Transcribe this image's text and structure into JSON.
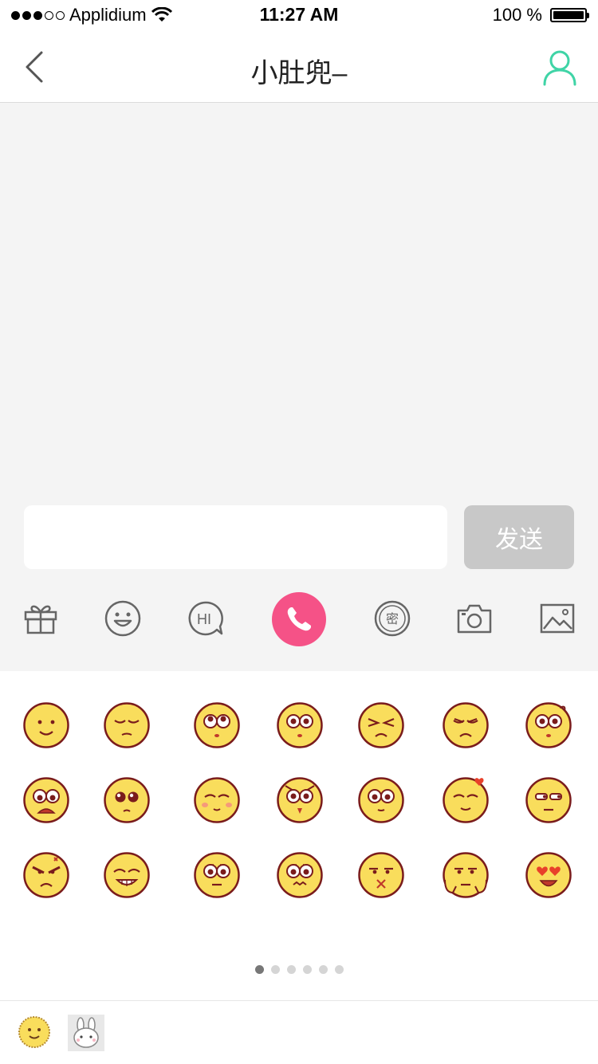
{
  "status_bar": {
    "carrier": "Applidium",
    "time": "11:27 AM",
    "battery": "100 %"
  },
  "nav": {
    "title": "小肚兜–"
  },
  "composer": {
    "input_value": "",
    "send_label": "发送"
  },
  "toolbar": {
    "items": [
      "gift-icon",
      "smiley-icon",
      "hi-bubble-icon",
      "phone-call-icon",
      "secret-stamp-icon",
      "camera-icon",
      "image-icon"
    ],
    "secret_glyph": "密",
    "hi_text": "HI",
    "call_color": "#f55287"
  },
  "emoji_panel": {
    "rows": [
      [
        "smile",
        "sleepy",
        "eyes-up",
        "stare",
        "squint",
        "sad",
        "confused"
      ],
      [
        "shocked",
        "sparkle-eyes",
        "blush",
        "owl",
        "dizzy",
        "love",
        "smirk"
      ],
      [
        "angry",
        "grin",
        "worried",
        "nervous",
        "x-mouth",
        "hug",
        "heart-eyes"
      ]
    ],
    "page_count": 6,
    "active_page": 1,
    "face_color": "#f9dd5c",
    "outline_color": "#7a1c1c"
  },
  "bottom_tabs": [
    {
      "name": "emoji-tab",
      "active": true
    },
    {
      "name": "bunny-sticker-tab",
      "active": false
    }
  ]
}
